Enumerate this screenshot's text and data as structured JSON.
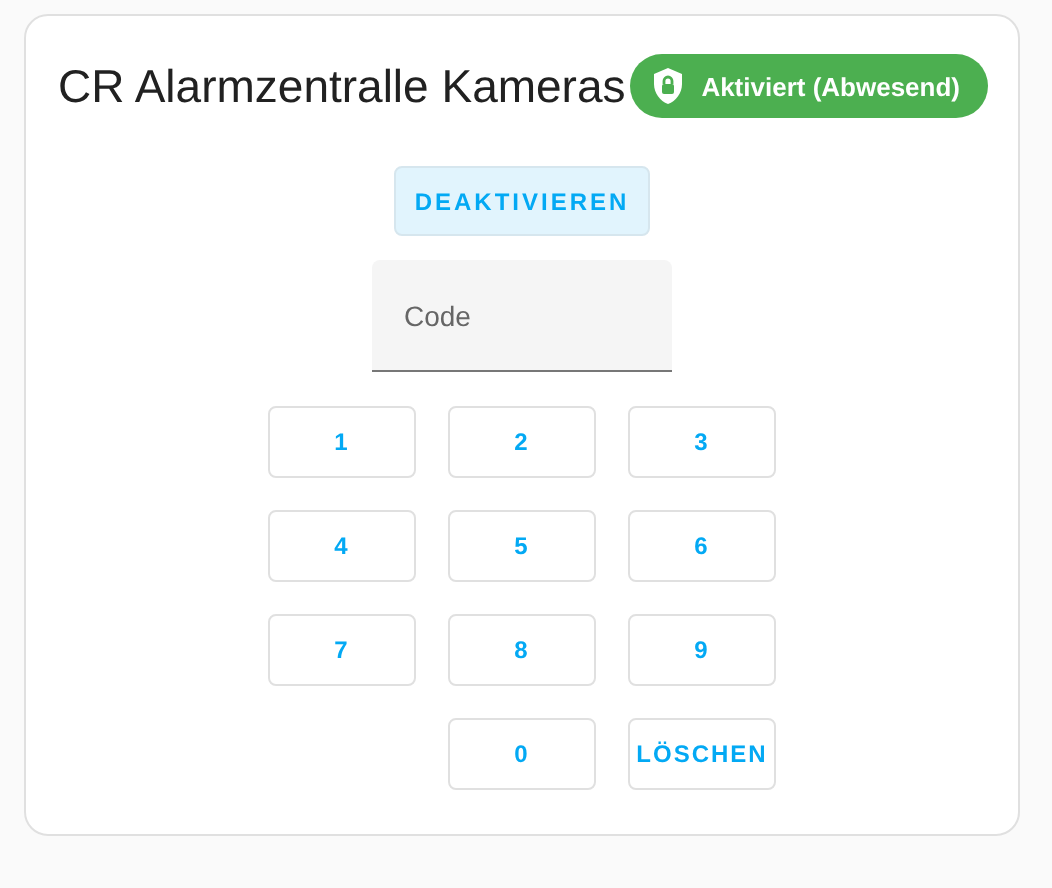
{
  "card": {
    "title": "CR Alarmzentralle Kameras",
    "status": {
      "label": "Aktiviert (Abwesend)",
      "kind": "armed"
    },
    "action_button": "DEAKTIVIEREN",
    "code_field": {
      "placeholder": "Code"
    },
    "keypad": [
      {
        "label": "1",
        "kind": "digit"
      },
      {
        "label": "2",
        "kind": "digit"
      },
      {
        "label": "3",
        "kind": "digit"
      },
      {
        "label": "4",
        "kind": "digit"
      },
      {
        "label": "5",
        "kind": "digit"
      },
      {
        "label": "6",
        "kind": "digit"
      },
      {
        "label": "7",
        "kind": "digit"
      },
      {
        "label": "8",
        "kind": "digit"
      },
      {
        "label": "9",
        "kind": "digit"
      },
      {
        "label": "0",
        "kind": "zero"
      },
      {
        "label": "LÖSCHEN",
        "kind": "clear"
      }
    ]
  }
}
